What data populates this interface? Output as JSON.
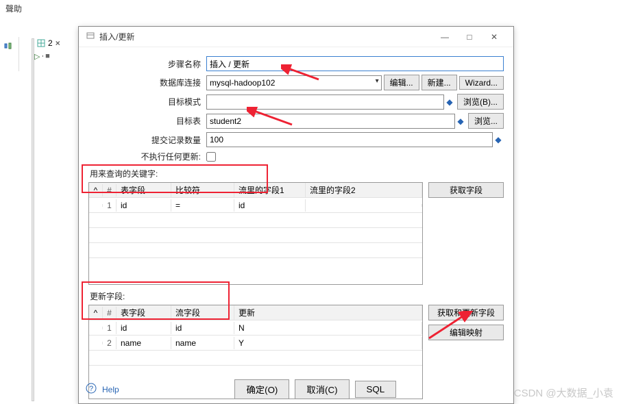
{
  "menu_help": "聲助",
  "tab_label": "2",
  "dialog": {
    "title": "插入/更新",
    "form": {
      "step_name_label": "步骤名称",
      "step_name_value": "插入 / 更新",
      "db_conn_label": "数据库连接",
      "db_conn_value": "mysql-hadoop102",
      "db_conn_edit": "编辑...",
      "db_conn_new": "新建...",
      "db_conn_wizard": "Wizard...",
      "target_schema_label": "目标模式",
      "target_schema_value": "",
      "browse_b": "浏览(B)...",
      "target_table_label": "目标表",
      "target_table_value": "student2",
      "browse": "浏览...",
      "commit_label": "提交记录数量",
      "commit_value": "100",
      "no_update_label": "不执行任何更新:"
    },
    "keys": {
      "section_label": "用来查询的关键字:",
      "hdr_num": "#",
      "hdr_field": "表字段",
      "hdr_comp": "比较符",
      "hdr_sf1": "流里的字段1",
      "hdr_sf2": "流里的字段2",
      "get_fields": "获取字段",
      "rows": [
        {
          "n": "1",
          "table_field": "id",
          "comp": "=",
          "sf1": "id",
          "sf2": ""
        }
      ]
    },
    "updates": {
      "section_label": "更新字段:",
      "hdr_num": "#",
      "hdr_field": "表字段",
      "hdr_sf": "流字段",
      "hdr_up": "更新",
      "get_update_fields": "获取和更新字段",
      "edit_mapping": "编辑映射",
      "rows": [
        {
          "n": "1",
          "table_field": "id",
          "stream_field": "id",
          "update": "N"
        },
        {
          "n": "2",
          "table_field": "name",
          "stream_field": "name",
          "update": "Y"
        }
      ]
    },
    "footer": {
      "help": "Help",
      "ok": "确定(O)",
      "cancel": "取消(C)",
      "sql": "SQL"
    }
  },
  "watermark": "CSDN @大数据_小袁"
}
